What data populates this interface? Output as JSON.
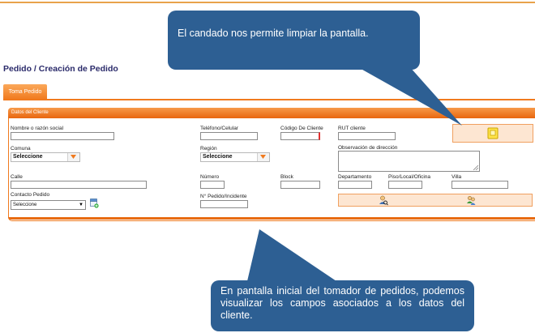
{
  "page": {
    "title": "Pedido / Creación de Pedido",
    "tab_label": "Toma Pedido",
    "section_title": "Datos del Cliente"
  },
  "form": {
    "nombre_label": "Nombre o razón social",
    "telefono_label": "Teléfono/Celular",
    "codigo_label": "Código De Cliente",
    "rut_label": "RUT cliente",
    "comuna_label": "Comuna",
    "comuna_value": "Seleccione",
    "region_label": "Región",
    "region_value": "Seleccione",
    "observacion_label": "Observación de dirección",
    "calle_label": "Calle",
    "numero_label": "Número",
    "block_label": "Block",
    "departamento_label": "Departamento",
    "piso_label": "Piso/Local/Oficina",
    "villa_label": "Villa",
    "contacto_label": "Contacto Pedido",
    "contacto_value": "Seleccione",
    "pedido_label": "N° Pedido/Incidente"
  },
  "icons": {
    "lock": "lock-icon",
    "add_contact": "add-contact-icon",
    "user_search": "user-search-icon",
    "user_group": "user-group-icon"
  },
  "callouts": {
    "lock_note": "El candado nos permite limpiar la pantalla.",
    "fields_note": "En pantalla inicial del tomador de pedidos, podemos visualizar los campos asociados a los datos del cliente."
  },
  "colors": {
    "accent_orange": "#f07a1e",
    "callout_blue": "#2d5f93",
    "title_navy": "#2a2a6a"
  }
}
